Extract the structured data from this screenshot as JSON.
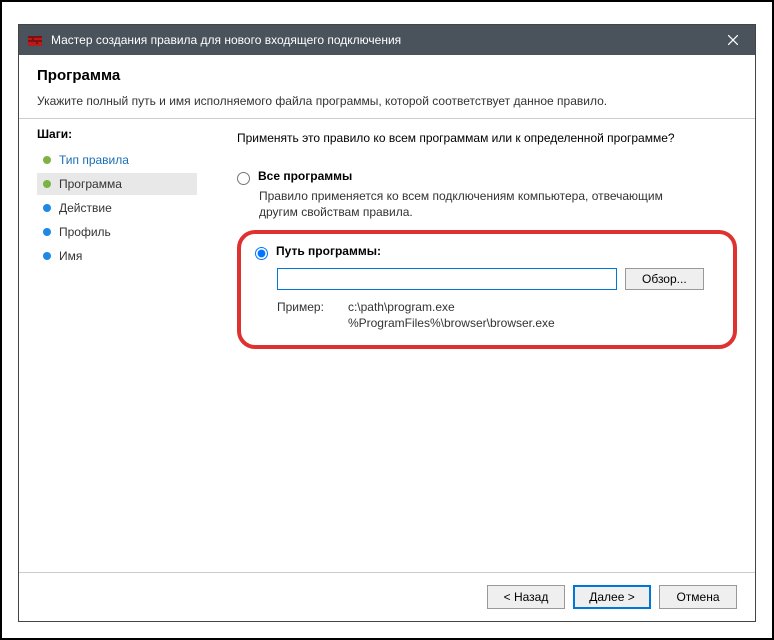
{
  "window": {
    "title": "Мастер создания правила для нового входящего подключения"
  },
  "header": {
    "title": "Программа",
    "subtitle": "Укажите полный путь и имя исполняемого файла программы, которой соответствует данное правило."
  },
  "steps": {
    "heading": "Шаги:",
    "items": [
      {
        "label": "Тип правила"
      },
      {
        "label": "Программа"
      },
      {
        "label": "Действие"
      },
      {
        "label": "Профиль"
      },
      {
        "label": "Имя"
      }
    ]
  },
  "content": {
    "question": "Применять это правило ко всем программам или к определенной программе?",
    "opt_all": {
      "label": "Все программы",
      "desc": "Правило применяется ко всем подключениям компьютера, отвечающим другим свойствам правила."
    },
    "opt_path": {
      "label": "Путь программы:",
      "value": "",
      "browse": "Обзор...",
      "example_label": "Пример:",
      "example_text": "c:\\path\\program.exe\n%ProgramFiles%\\browser\\browser.exe"
    }
  },
  "footer": {
    "back": "< Назад",
    "next": "Далее >",
    "cancel": "Отмена"
  }
}
